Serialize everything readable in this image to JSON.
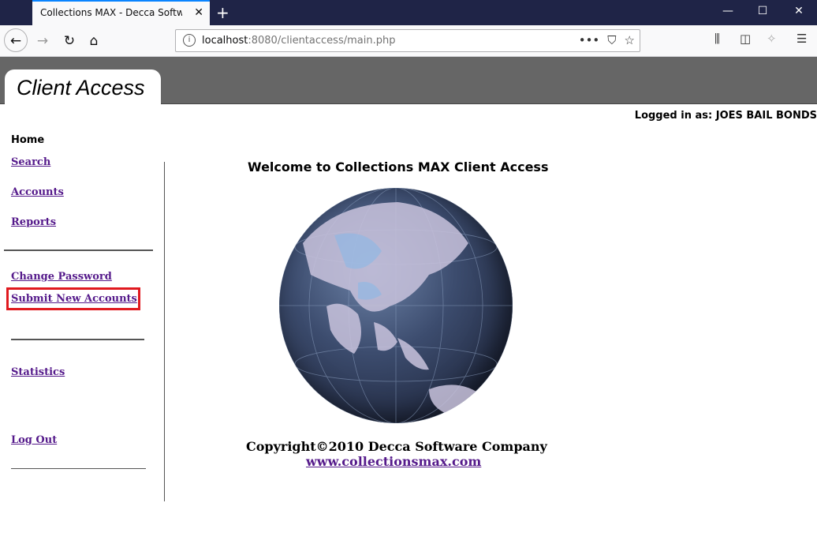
{
  "browser": {
    "tab_title": "Collections MAX - Decca Software C",
    "new_tab_symbol": "+",
    "url_host": "localhost",
    "url_rest": ":8080/clientaccess/main.php",
    "window_controls": [
      "minimize-icon",
      "maximize-icon",
      "close-icon"
    ]
  },
  "header": {
    "title": "Client Access",
    "logged_in": "Logged in as: JOES BAIL BONDS"
  },
  "sidebar": {
    "home": "Home",
    "items": [
      {
        "label": "Search"
      },
      {
        "label": "Accounts"
      },
      {
        "label": "Reports"
      },
      {
        "label": "Change Password"
      },
      {
        "label": "Submit New Accounts"
      },
      {
        "label": "Statistics"
      },
      {
        "label": "Log Out"
      }
    ],
    "highlight_color": "#e0191f",
    "link_color": "#551a8b"
  },
  "main": {
    "welcome": "Welcome to Collections MAX Client Access",
    "image": "globe-image",
    "copyright": "Copyright©2010 Decca Software Company",
    "website": "www.collectionsmax.com"
  },
  "colors": {
    "tabstrip": "#1f2447",
    "header_bar": "#666666"
  }
}
